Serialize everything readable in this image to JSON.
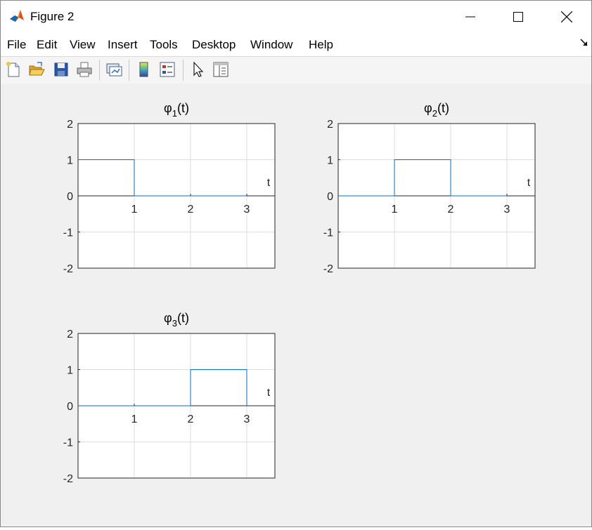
{
  "window": {
    "title": "Figure 2",
    "icon": "matlab-logo-icon",
    "controls": [
      "minimize-icon",
      "maximize-icon",
      "close-icon"
    ]
  },
  "menu": [
    "File",
    "Edit",
    "View",
    "Insert",
    "Tools",
    "Desktop",
    "Window",
    "Help"
  ],
  "toolbar": {
    "buttons": [
      "new-figure-icon",
      "open-file-icon",
      "save-icon",
      "print-icon",
      "link-plot-icon",
      "insert-colorbar-icon",
      "insert-legend-icon",
      "pointer-icon",
      "property-inspector-icon"
    ]
  },
  "colors": {
    "line": "#0072bd",
    "grid": "#dddddd",
    "axes_bg": "#ffffff",
    "figure_bg": "#f0f0f0"
  },
  "chart_data": [
    {
      "type": "line",
      "title": "φ",
      "title_sub": "1",
      "title_suffix": "(t)",
      "xlabel": "t",
      "xlim": [
        0,
        3.5
      ],
      "ylim": [
        -2,
        2
      ],
      "xticks": [
        1,
        2,
        3
      ],
      "yticks": [
        2,
        1,
        0,
        -1,
        -2
      ],
      "grid": true,
      "x": [
        0,
        1,
        1,
        3
      ],
      "y": [
        1,
        1,
        0,
        0
      ]
    },
    {
      "type": "line",
      "title": "φ",
      "title_sub": "2",
      "title_suffix": "(t)",
      "xlabel": "t",
      "xlim": [
        0,
        3.5
      ],
      "ylim": [
        -2,
        2
      ],
      "xticks": [
        1,
        2,
        3
      ],
      "yticks": [
        2,
        1,
        0,
        -1,
        -2
      ],
      "grid": true,
      "x": [
        0,
        1,
        1,
        2,
        2,
        3
      ],
      "y": [
        0,
        0,
        1,
        1,
        0,
        0
      ]
    },
    {
      "type": "line",
      "title": "φ",
      "title_sub": "3",
      "title_suffix": "(t)",
      "xlabel": "t",
      "xlim": [
        0,
        3.5
      ],
      "ylim": [
        -2,
        2
      ],
      "xticks": [
        1,
        2,
        3
      ],
      "yticks": [
        2,
        1,
        0,
        -1,
        -2
      ],
      "grid": true,
      "x": [
        0,
        2,
        2,
        3,
        3
      ],
      "y": [
        0,
        0,
        1,
        1,
        0
      ]
    }
  ]
}
